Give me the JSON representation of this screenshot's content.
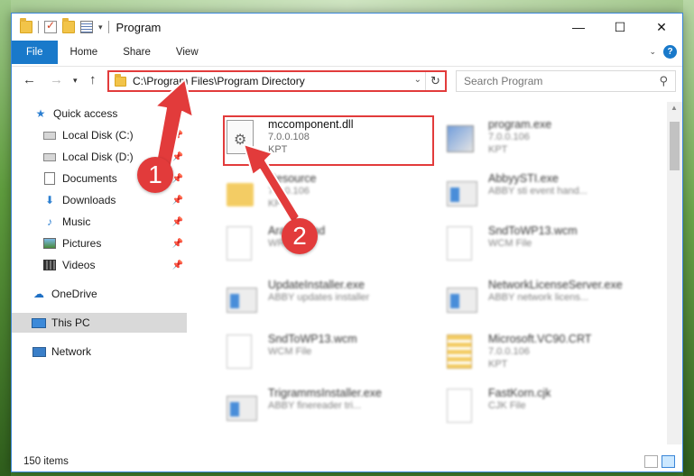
{
  "window": {
    "title": "Program"
  },
  "ribbon": {
    "tabs": [
      "File",
      "Home",
      "Share",
      "View"
    ],
    "help": "?"
  },
  "address": {
    "path": "C:\\Program Files\\Program Directory",
    "search_placeholder": "Search Program"
  },
  "sidebar": {
    "items": [
      {
        "label": "Quick access",
        "icon": "star-icon"
      },
      {
        "label": "Local Disk (C:)",
        "icon": "drive-icon",
        "pinned": true
      },
      {
        "label": "Local Disk (D:)",
        "icon": "drive-icon",
        "pinned": true
      },
      {
        "label": "Documents",
        "icon": "documents-icon",
        "pinned": true
      },
      {
        "label": "Downloads",
        "icon": "downloads-icon",
        "pinned": true
      },
      {
        "label": "Music",
        "icon": "music-icon",
        "pinned": true
      },
      {
        "label": "Pictures",
        "icon": "pictures-icon",
        "pinned": true
      },
      {
        "label": "Videos",
        "icon": "videos-icon",
        "pinned": true
      },
      {
        "label": "OneDrive",
        "icon": "onedrive-icon"
      },
      {
        "label": "This PC",
        "icon": "this-pc-icon"
      },
      {
        "label": "Network",
        "icon": "network-icon"
      }
    ]
  },
  "files": [
    {
      "name": "mccomponent.dll",
      "line1": "7.0.0.108",
      "line2": "KPT",
      "icon": "dll-icon"
    },
    {
      "name": "program.exe",
      "line1": "7.0.0.106",
      "line2": "KPT",
      "icon": "program-icon"
    },
    {
      "name": "Resource",
      "line1": "7.0.0.106",
      "line2": "KPT",
      "icon": "folder-icon"
    },
    {
      "name": "AbbyySTI.exe",
      "line1": "ABBY sti event hand...",
      "line2": "",
      "icon": "exe-icon"
    },
    {
      "name": "Arabic.amd",
      "line1": "WRD File",
      "line2": "",
      "icon": "document-icon"
    },
    {
      "name": "SndToWP13.wcm",
      "line1": "WCM File",
      "line2": "",
      "icon": "document-icon"
    },
    {
      "name": "UpdateInstaller.exe",
      "line1": "ABBY updates installer",
      "line2": "",
      "icon": "exe-icon"
    },
    {
      "name": "NetworkLicenseServer.exe",
      "line1": "ABBY network licens...",
      "line2": "",
      "icon": "exe-icon"
    },
    {
      "name": "SndToWP13.wcm",
      "line1": "WCM File",
      "line2": "",
      "icon": "document-icon"
    },
    {
      "name": "Microsoft.VC90.CRT",
      "line1": "7.0.0.106",
      "line2": "KPT",
      "icon": "zip-icon"
    },
    {
      "name": "TrigrammsInstaller.exe",
      "line1": "ABBY finereader tri...",
      "line2": "",
      "icon": "exe-icon"
    },
    {
      "name": "FastKorn.cjk",
      "line1": "CJK File",
      "line2": "",
      "icon": "document-icon"
    }
  ],
  "status": {
    "count": "150 items"
  },
  "callouts": [
    "1",
    "2"
  ],
  "colors": {
    "accent": "#1979ca",
    "highlight": "#e23b3b",
    "selected": "#d9d9d9"
  }
}
